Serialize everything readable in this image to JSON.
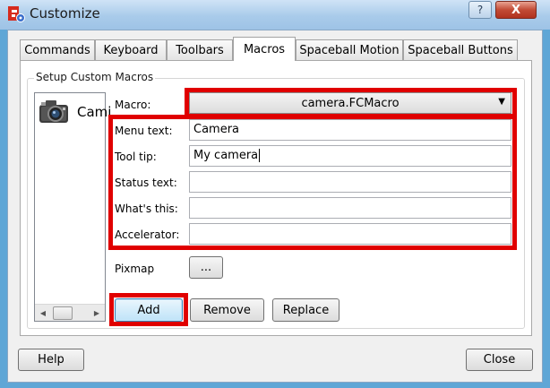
{
  "window": {
    "title": "Customize",
    "minimize_glyph": "?",
    "close_glyph": "X"
  },
  "tabs": [
    {
      "label": "Commands"
    },
    {
      "label": "Keyboard"
    },
    {
      "label": "Toolbars"
    },
    {
      "label": "Macros"
    },
    {
      "label": "Spaceball Motion"
    },
    {
      "label": "Spaceball Buttons"
    }
  ],
  "group": {
    "title": "Setup Custom Macros"
  },
  "macro_list": {
    "item_label": "Cami",
    "item_icon": "camera-icon"
  },
  "macro": {
    "label": "Macro:",
    "value": "camera.FCMacro"
  },
  "fields": {
    "menu_text_label": "Menu text:",
    "menu_text_value": "Camera",
    "tool_tip_label": "Tool tip:",
    "tool_tip_value": "My camera",
    "status_text_label": "Status text:",
    "status_text_value": "",
    "whats_this_label": "What's this:",
    "whats_this_value": "",
    "accelerator_label": "Accelerator:",
    "accelerator_value": ""
  },
  "pixmap": {
    "label": "Pixmap",
    "button": "..."
  },
  "buttons": {
    "add": "Add",
    "remove": "Remove",
    "replace": "Replace",
    "help": "Help",
    "close": "Close"
  },
  "colors": {
    "highlight": "#e00000",
    "title_bar": "#a9cbea"
  }
}
